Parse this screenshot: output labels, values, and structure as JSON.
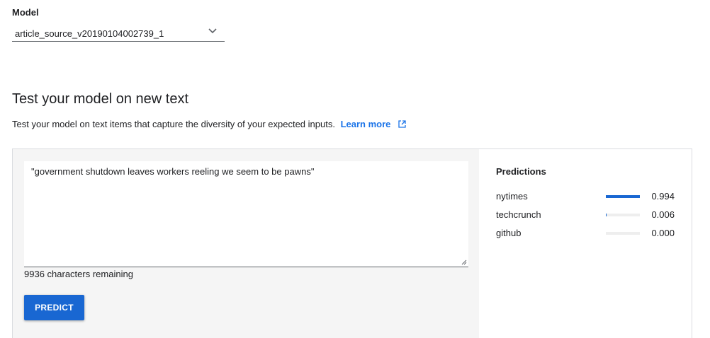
{
  "model": {
    "label": "Model",
    "selected": "article_source_v20190104002739_1"
  },
  "test_section": {
    "title": "Test your model on new text",
    "description": "Test your model on text items that capture the diversity of your expected inputs.",
    "learn_more": "Learn more"
  },
  "input": {
    "text": "\"government shutdown leaves workers reeling we seem to be pawns\"",
    "chars_remaining": "9936 characters remaining"
  },
  "predict_button": "PREDICT",
  "predictions": {
    "title": "Predictions",
    "items": [
      {
        "label": "nytimes",
        "score": "0.994",
        "value": 0.994
      },
      {
        "label": "techcrunch",
        "score": "0.006",
        "value": 0.006
      },
      {
        "label": "github",
        "score": "0.000",
        "value": 0.0
      }
    ]
  },
  "colors": {
    "accent": "#1967d2",
    "link": "#1a73e8",
    "panel_bg": "#f5f5f5"
  },
  "icons": {
    "dropdown": "chevron-down-icon",
    "external_link": "external-link-icon",
    "resize": "resize-grip-icon"
  }
}
